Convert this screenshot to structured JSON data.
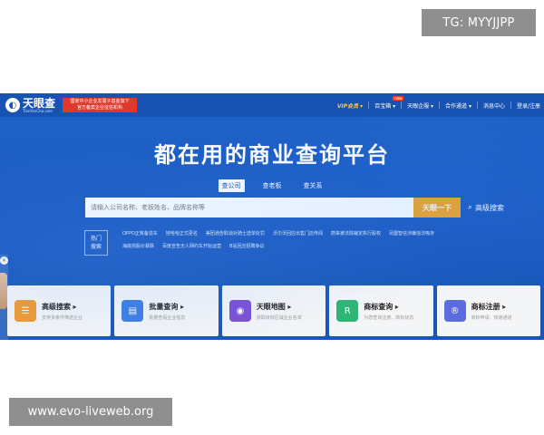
{
  "watermark_top": "TG: MYYJJPP",
  "watermark_bottom": "www.evo-liveweb.org",
  "nav": {
    "logo_name": "天眼查",
    "logo_url": "TianYanCha.com",
    "logo_glyph": "◐",
    "badge_line1": "国家中小企业发展子基金旗下",
    "badge_line2": "官方备案企业征信机构",
    "items": {
      "vip": "VIP会员 ▾",
      "baodian": "百宝箱 ▾",
      "baodian_flag": "new",
      "qiye": "天眼企服 ▾",
      "hezuo": "合作通道 ▾",
      "xiaoxi": "消息中心",
      "login": "登录/注册"
    }
  },
  "hero": {
    "title": "都在用的商业查询平台"
  },
  "search": {
    "tabs": [
      "查公司",
      "查老板",
      "查关系"
    ],
    "active_tab": 0,
    "placeholder": "请输入公司名称、老板姓名、品牌名称等",
    "value": "",
    "button_label": "天眼一下",
    "advanced_label": "高级搜索",
    "advanced_icon": "search-icon"
  },
  "hot": {
    "label_line1": "热门",
    "label_line2": "搜索",
    "items": [
      "OPPO正筹备造车",
      "娃哈哈正式更名",
      "美团通告取消对骑士送单处罚",
      "沃尔沃回应出售门店传闻",
      "蔚来被法院裁定执行股权",
      "凤凰智信涉嫌违法吸存",
      "海底捞股价暴跌",
      "百度宣告无人网约车开始运营",
      "B站回应招聘争议"
    ]
  },
  "cards": [
    {
      "title": "高级搜索",
      "sub": "支持多条件筛选企业",
      "icon": "advanced-search-icon",
      "glyph": "☰",
      "color": "#f29a2e"
    },
    {
      "title": "批量查询",
      "sub": "批量查看企业信息",
      "icon": "batch-query-icon",
      "glyph": "▤",
      "color": "#3e7de0"
    },
    {
      "title": "天眼地图",
      "sub": "获取目标区域企业名单",
      "icon": "map-pin-icon",
      "glyph": "◉",
      "color": "#7b4fd6"
    },
    {
      "title": "商标查询",
      "sub": "为您查询注册、商标状态",
      "icon": "trademark-query-icon",
      "glyph": "R",
      "color": "#2fb574"
    },
    {
      "title": "商标注册",
      "sub": "商标申请、快速通道",
      "icon": "trademark-register-icon",
      "glyph": "®",
      "color": "#5b6be0"
    }
  ],
  "colors": {
    "primary_blue": "#1853b4",
    "accent_orange": "#f5a623",
    "vip_gold": "#ffc93c",
    "badge_red": "#e0392b"
  }
}
